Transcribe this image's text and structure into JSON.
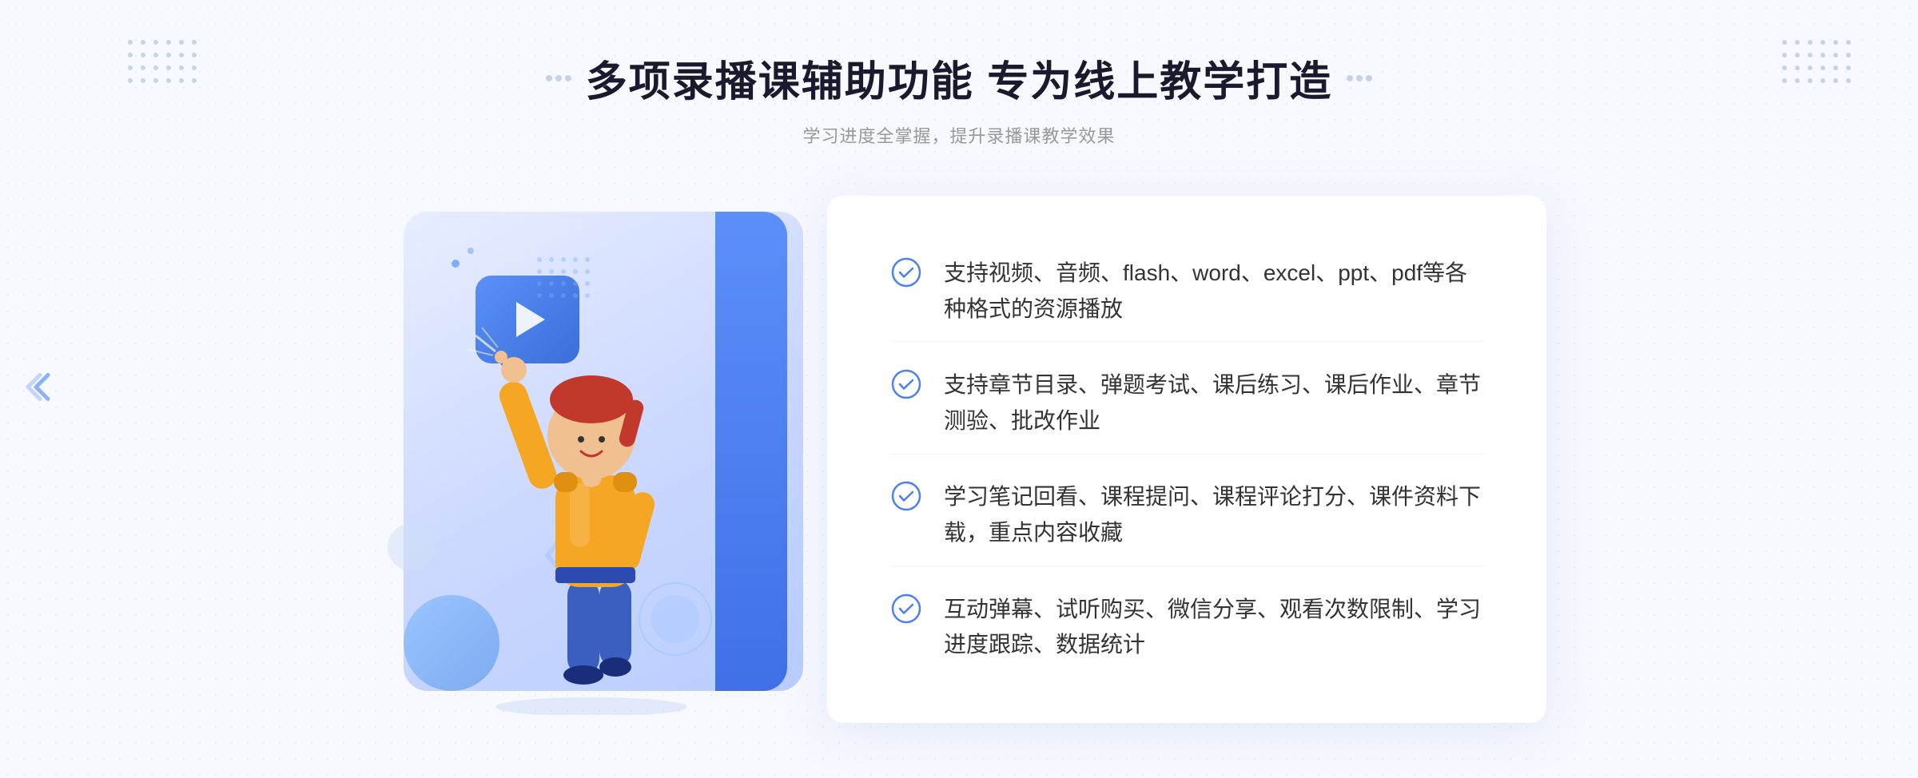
{
  "header": {
    "title_prefix_dots": true,
    "main_title": "多项录播课辅助功能 专为线上教学打造",
    "sub_title": "学习进度全掌握，提升录播课教学效果",
    "title_suffix_dots": true
  },
  "features": [
    {
      "id": 1,
      "text": "支持视频、音频、flash、word、excel、ppt、pdf等各种格式的资源播放"
    },
    {
      "id": 2,
      "text": "支持章节目录、弹题考试、课后练习、课后作业、章节测验、批改作业"
    },
    {
      "id": 3,
      "text": "学习笔记回看、课程提问、课程评论打分、课件资料下载，重点内容收藏"
    },
    {
      "id": 4,
      "text": "互动弹幕、试听购买、微信分享、观看次数限制、学习进度跟踪、数据统计"
    }
  ],
  "colors": {
    "primary_blue": "#4a80f0",
    "light_blue": "#7ab0ff",
    "text_dark": "#1a1a2e",
    "text_gray": "#999999",
    "text_body": "#333333",
    "bg_light": "#f8f9ff",
    "check_color": "#4a80f0"
  }
}
